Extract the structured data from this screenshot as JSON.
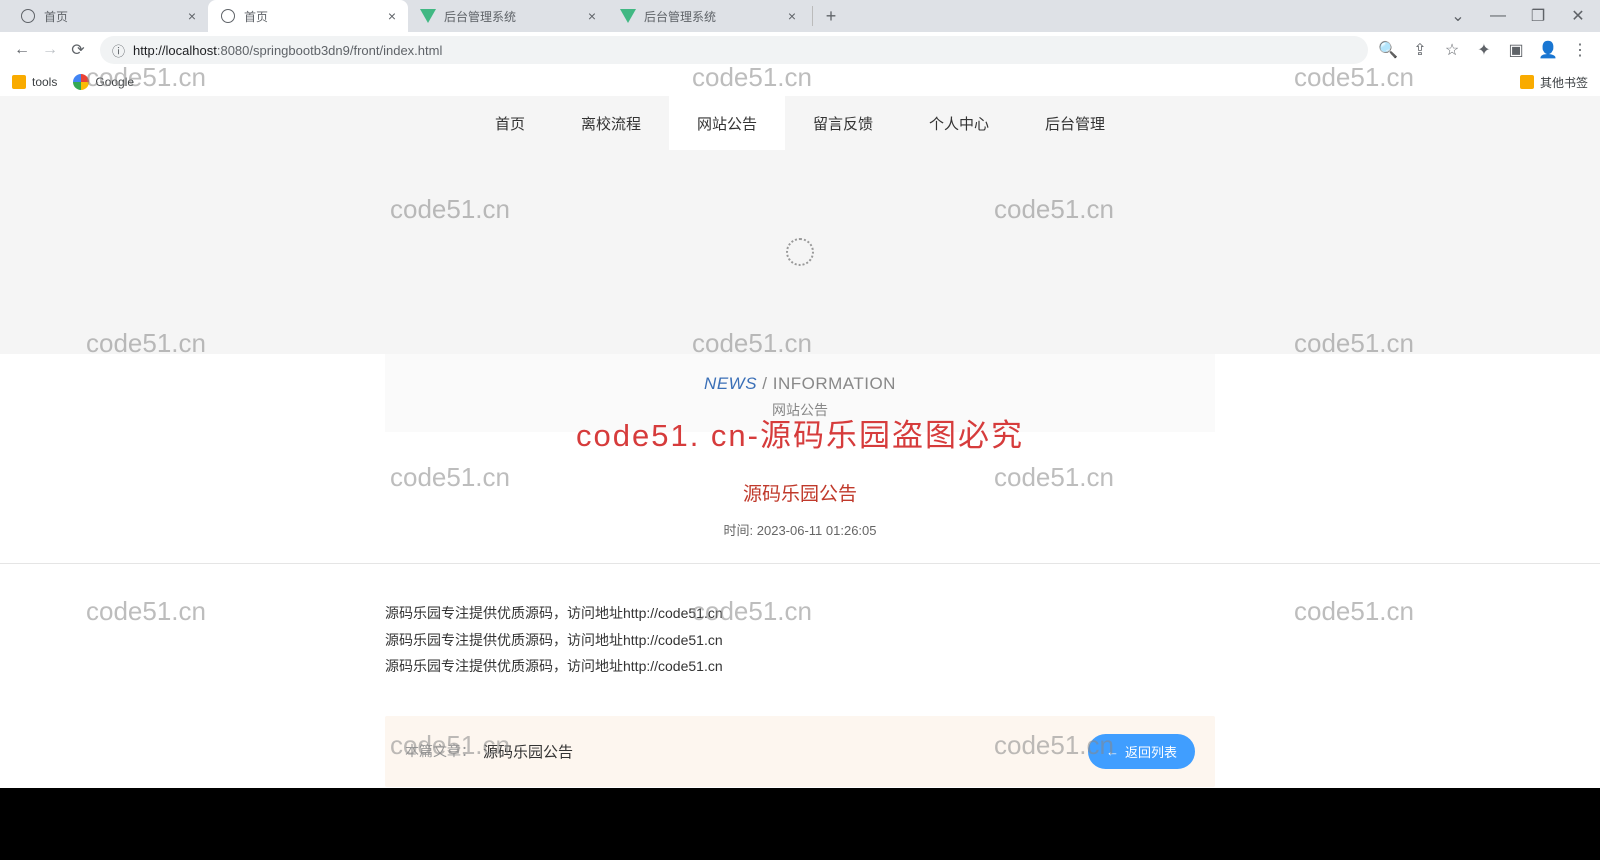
{
  "browser": {
    "tabs": [
      {
        "title": "首页",
        "type": "globe"
      },
      {
        "title": "首页",
        "type": "globe",
        "active": true
      },
      {
        "title": "后台管理系统",
        "type": "vue"
      },
      {
        "title": "后台管理系统",
        "type": "vue"
      }
    ],
    "url_prefix": "http://",
    "url_host": "localhost",
    "url_rest": ":8080/springbootb3dn9/front/index.html",
    "bookmarks": {
      "tools": "tools",
      "google": "Google",
      "other": "其他书签"
    }
  },
  "nav": {
    "items": [
      "首页",
      "离校流程",
      "网站公告",
      "留言反馈",
      "个人中心",
      "后台管理"
    ],
    "active_index": 2
  },
  "section": {
    "en_left": "NEWS",
    "en_sep": " / ",
    "en_right": "INFORMATION",
    "cn": "网站公告"
  },
  "watermark_main": "code51. cn-源码乐园盗图必究",
  "watermark_bg": "code51.cn",
  "article": {
    "title": "源码乐园公告",
    "time_label": "时间:",
    "time_value": "2023-06-11 01:26:05",
    "body": [
      "源码乐园专注提供优质源码，访问地址http://code51.cn",
      "源码乐园专注提供优质源码，访问地址http://code51.cn",
      "源码乐园专注提供优质源码，访问地址http://code51.cn"
    ],
    "footer_label": "本篇文章：",
    "footer_title": "源码乐园公告",
    "back_button": "返回列表"
  }
}
